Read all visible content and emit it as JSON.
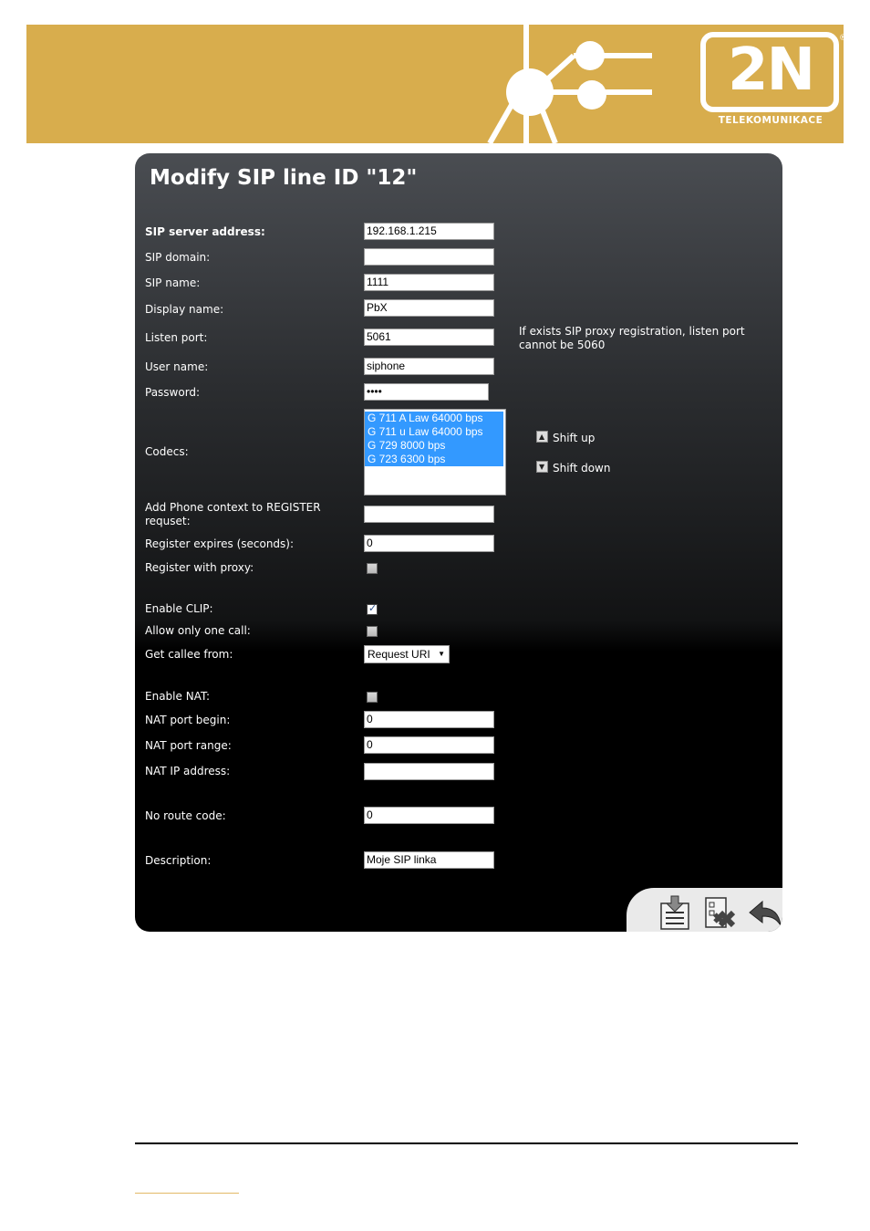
{
  "brand": {
    "logo": "2N",
    "subtitle": "TELEKOMUNIKACE",
    "registered": "®",
    "color": "#d8ad4d"
  },
  "page": {
    "title": "Modify SIP line ID \"12\""
  },
  "form": {
    "sip_server_address": {
      "label": "SIP server address:",
      "value": "192.168.1.215"
    },
    "sip_domain": {
      "label": "SIP domain:",
      "value": ""
    },
    "sip_name": {
      "label": "SIP name:",
      "value": "1111"
    },
    "display_name": {
      "label": "Display name:",
      "value": "PbX"
    },
    "listen_port": {
      "label": "Listen port:",
      "value": "5061",
      "note": "If exists SIP proxy registration, listen port cannot be 5060"
    },
    "user_name": {
      "label": "User name:",
      "value": "siphone"
    },
    "password": {
      "label": "Password:",
      "value": "••••"
    },
    "codecs": {
      "label": "Codecs:",
      "options": [
        "G 711 A Law 64000 bps",
        "G 711 u Law 64000 bps",
        "G 729 8000 bps",
        "G 723 6300 bps"
      ],
      "shift_up": "Shift up",
      "shift_down": "Shift down"
    },
    "phone_context": {
      "label": "Add Phone context to REGISTER requset:",
      "value": ""
    },
    "register_expires": {
      "label": "Register expires (seconds):",
      "value": "0"
    },
    "register_with_proxy": {
      "label": "Register with proxy:",
      "checked": false
    },
    "enable_clip": {
      "label": "Enable CLIP:",
      "checked": true
    },
    "allow_one_call": {
      "label": "Allow only one call:",
      "checked": false
    },
    "get_callee_from": {
      "label": "Get callee from:",
      "value": "Request URI"
    },
    "enable_nat": {
      "label": "Enable NAT:",
      "checked": false
    },
    "nat_port_begin": {
      "label": "NAT port begin:",
      "value": "0"
    },
    "nat_port_range": {
      "label": "NAT port range:",
      "value": "0"
    },
    "nat_ip_address": {
      "label": "NAT IP address:",
      "value": ""
    },
    "no_route_code": {
      "label": "No route code:",
      "value": "0"
    },
    "description": {
      "label": "Description:",
      "value": "Moje SIP linka"
    }
  },
  "toolbar": {
    "save_icon": "save-icon",
    "delete_icon": "delete-icon",
    "back_icon": "back-arrow-icon"
  }
}
